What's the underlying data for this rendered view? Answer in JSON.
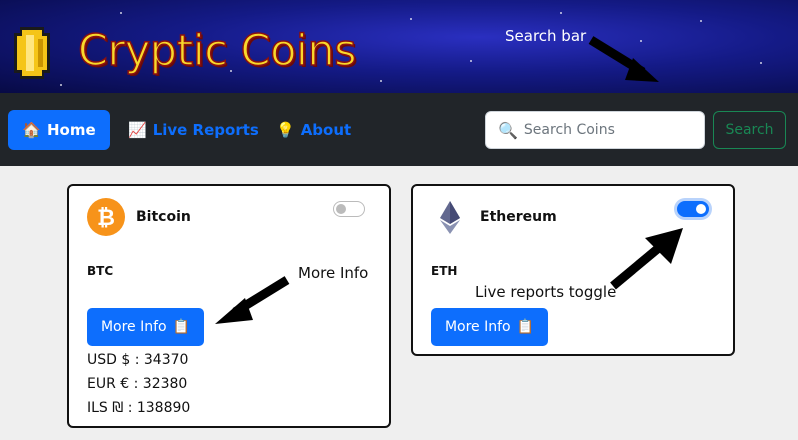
{
  "header": {
    "brand": "Cryptic Coins",
    "annotation": "Search bar"
  },
  "nav": {
    "home": "Home",
    "live_reports": "Live Reports",
    "about": "About",
    "search_placeholder": "Search Coins",
    "search_button": "Search"
  },
  "coins": [
    {
      "name": "Bitcoin",
      "symbol": "BTC",
      "toggle_on": false,
      "more_info": "More Info",
      "prices": [
        "USD $ : 34370",
        "EUR € : 32380",
        "ILS ₪ : 138890"
      ],
      "color": "#f7931a"
    },
    {
      "name": "Ethereum",
      "symbol": "ETH",
      "toggle_on": true,
      "more_info": "More Info",
      "color": "#627eea"
    }
  ],
  "annotations": {
    "more_info": "More Info",
    "live_reports_toggle": "Live reports toggle"
  },
  "colors": {
    "primary": "#0d6efd",
    "success": "#198754",
    "navbar": "#212529",
    "brand": "#f9d92b"
  },
  "icons": [
    "house-icon",
    "chart-icon",
    "lightbulb-icon",
    "magnifier-icon",
    "clipboard-icon",
    "coin-icon"
  ]
}
